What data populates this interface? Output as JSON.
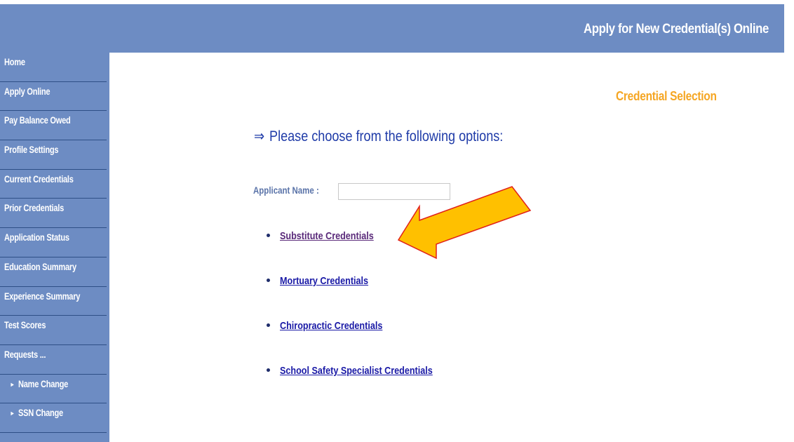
{
  "header": {
    "title": "Apply for New Credential(s) Online",
    "color": "#6d8cc3"
  },
  "sidebar": {
    "items": [
      {
        "label": "Home"
      },
      {
        "label": "Apply Online"
      },
      {
        "label": "Pay Balance Owed"
      },
      {
        "label": "Profile Settings"
      },
      {
        "label": "Current Credentials"
      },
      {
        "label": "Prior Credentials"
      },
      {
        "label": "Application Status"
      },
      {
        "label": "Education Summary"
      },
      {
        "label": "Experience Summary"
      },
      {
        "label": "Test Scores"
      },
      {
        "label": "Requests ..."
      },
      {
        "label": "Name Change",
        "icon": "triangle-right-icon"
      },
      {
        "label": "SSN Change",
        "icon": "triangle-right-icon"
      }
    ]
  },
  "main": {
    "section_title": "Credential Selection",
    "prompt": "Please choose from the following options:",
    "prompt_icon": "double-arrow-right-icon",
    "applicant_label": "Applicant Name :",
    "applicant_value": "",
    "options": [
      {
        "label": "Substitute Credentials",
        "visited": true
      },
      {
        "label": "Mortuary Credentials"
      },
      {
        "label": "Chiropractic Credentials"
      },
      {
        "label": "School Safety Specialist Credentials"
      }
    ]
  },
  "annotation": {
    "icon": "callout-arrow-icon",
    "fill": "#ffc000",
    "stroke": "#e0201a"
  },
  "colors": {
    "accent": "#f5a623",
    "link": "#1a1aa6",
    "visited_link": "#5a2a7a",
    "prompt": "#1f3ba8"
  }
}
